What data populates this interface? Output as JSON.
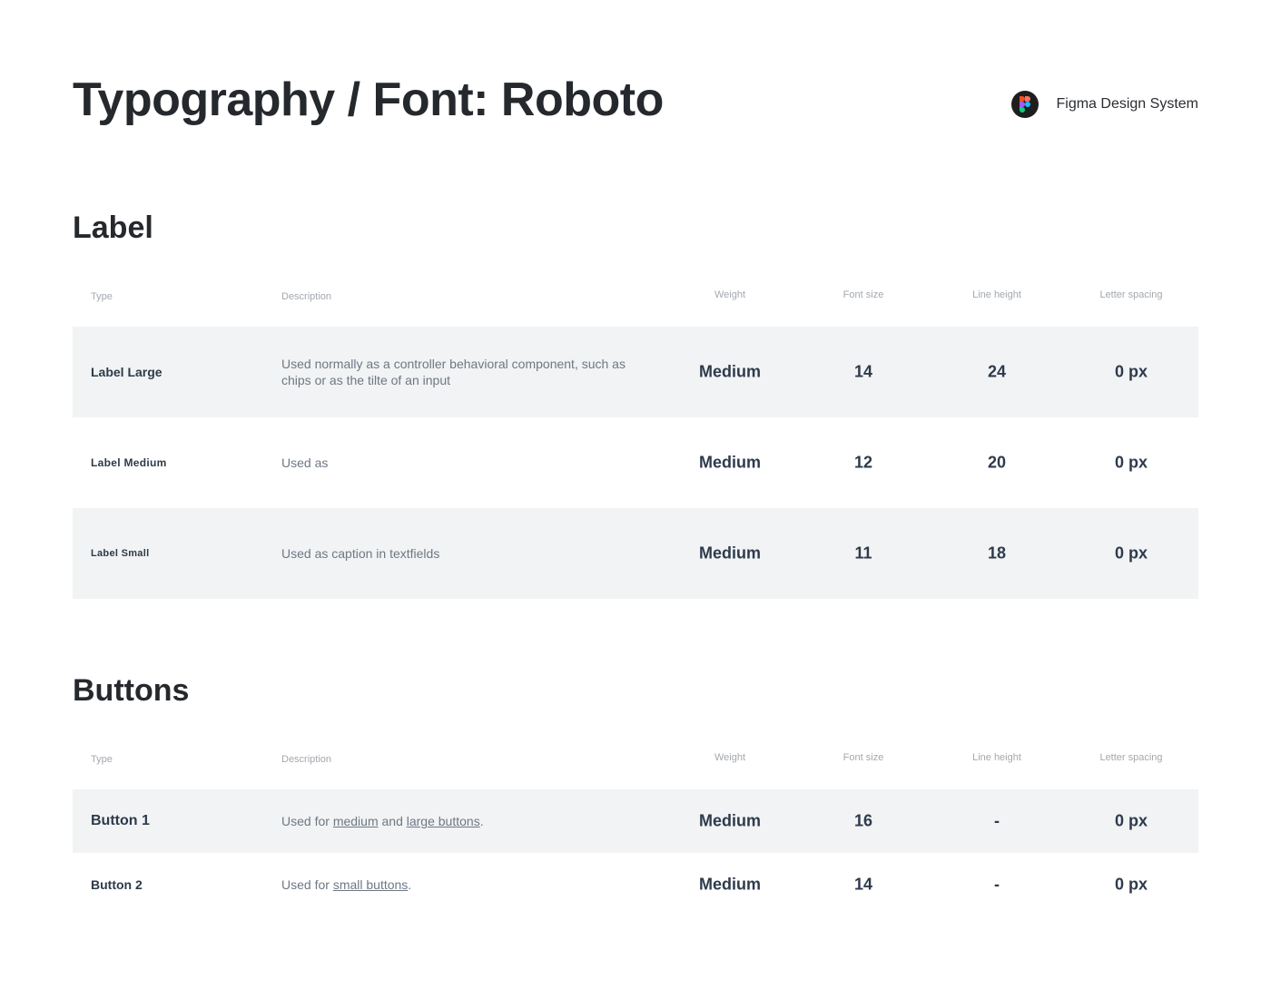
{
  "header": {
    "title": "Typography / Font: Roboto",
    "brand_label": "Figma Design System",
    "brand_icon": "figma-logo-icon"
  },
  "columns": {
    "type": "Type",
    "description": "Description",
    "weight": "Weight",
    "font_size": "Font size",
    "line_height": "Line height",
    "letter_spacing": "Letter spacing"
  },
  "label_section": {
    "title": "Label",
    "rows": [
      {
        "type": "Label Large",
        "description": "Used normally as a controller behavioral component, such as chips or as the tilte of an input",
        "weight": "Medium",
        "font_size": "14",
        "line_height": "24",
        "letter_spacing": "0 px"
      },
      {
        "type": "Label Medium",
        "description": "Used as",
        "weight": "Medium",
        "font_size": "12",
        "line_height": "20",
        "letter_spacing": "0 px"
      },
      {
        "type": "Label Small",
        "description": "Used as caption in textfields",
        "weight": "Medium",
        "font_size": "11",
        "line_height": "18",
        "letter_spacing": "0 px"
      }
    ]
  },
  "buttons_section": {
    "title": "Buttons",
    "rows": [
      {
        "type": "Button 1",
        "desc_prefix": "Used for ",
        "desc_link1": "medium",
        "desc_mid": " and ",
        "desc_link2": "large buttons",
        "desc_suffix": ".",
        "weight": "Medium",
        "font_size": "16",
        "line_height": "-",
        "letter_spacing": "0 px"
      },
      {
        "type": "Button 2",
        "desc_prefix": "Used for ",
        "desc_link1": "small buttons",
        "desc_suffix": ".",
        "weight": "Medium",
        "font_size": "14",
        "line_height": "-",
        "letter_spacing": "0 px"
      }
    ]
  },
  "colors": {
    "row_alt_bg": "#f1f3f4",
    "title": "#25282c",
    "muted": "#a3a8ae"
  }
}
